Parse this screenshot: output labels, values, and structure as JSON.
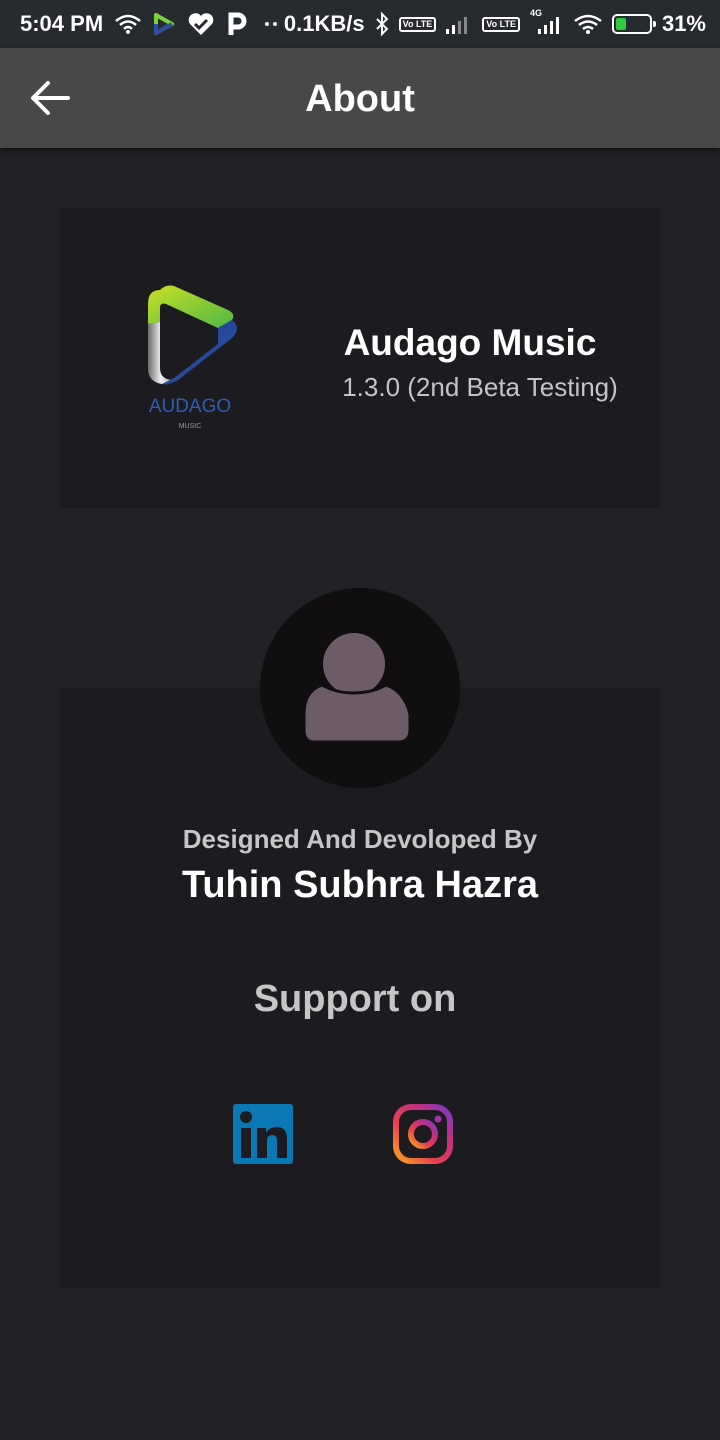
{
  "status_bar": {
    "time": "5:04 PM",
    "net_speed": "0.1KB/s",
    "volte_label_1": "Vo LTE",
    "volte_label_2": "Vo LTE",
    "network_type": "4G",
    "battery": "31%",
    "battery_level": 0.31
  },
  "header": {
    "title": "About",
    "back_icon": "arrow-left-icon"
  },
  "app_info": {
    "logo_text": "AUDAGO",
    "logo_subtext": "MUSIC",
    "name": "Audago Music",
    "version": "1.3.0  (2nd Beta Testing)"
  },
  "developer": {
    "avatar_icon": "person-icon",
    "designed_by_label": "Designed And Devoloped By",
    "name": "Tuhin Subhra Hazra"
  },
  "support": {
    "label": "Support on",
    "links": [
      {
        "icon": "linkedin-icon"
      },
      {
        "icon": "instagram-icon"
      }
    ]
  },
  "colors": {
    "background": "#212226",
    "app_bar": "#484848",
    "card": "#1c1c20",
    "linkedin": "#0a78b5",
    "avatar_silhouette": "#6e5b68"
  }
}
